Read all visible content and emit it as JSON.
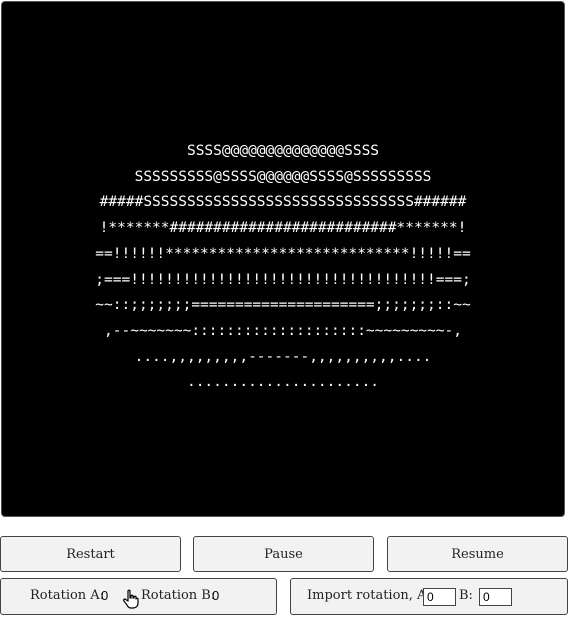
{
  "display": {
    "lines": [
      "SSSS@@@@@@@@@@@@@@SSSS",
      "SSSSSSSSS@SSSS@@@@@@SSSS@SSSSSSSSS",
      "#####SSSSSSSSSSSSSSSSSSSSSSSSSSSSSSS######",
      "!*******##########################*******!",
      "==!!!!!!****************************!!!!!==",
      ";===!!!!!!!!!!!!!!!!!!!!!!!!!!!!!!!!!!!===;",
      "~~::;;;;;;;=====================;;;;;;;::~~",
      ",--~~~~~~~::::::::::::::::::::~~~~~~~~~-,",
      "....,,,,,,,,,-------,,,,,,,,,,....",
      "......................"
    ]
  },
  "controls": {
    "restart_label": "Restart",
    "pause_label": "Pause",
    "resume_label": "Resume"
  },
  "rotation": {
    "a_label": "Rotation A:",
    "a_value": "0",
    "b_label": "Rotation B:",
    "b_value": "0"
  },
  "import": {
    "label": "Import rotation, A:",
    "a_value": "0",
    "b_label": "B:",
    "b_value": "0"
  }
}
